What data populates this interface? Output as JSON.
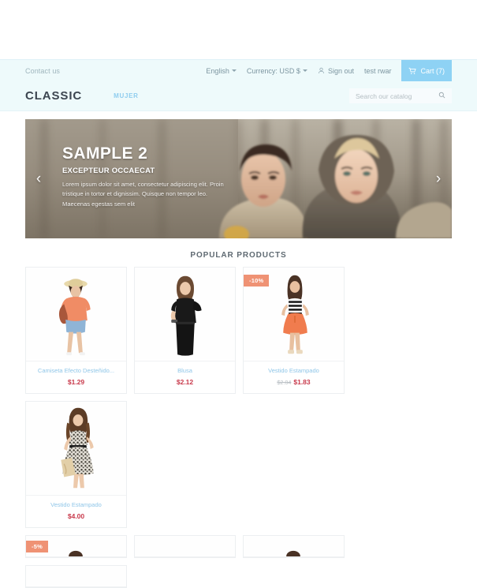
{
  "topbar": {
    "contact_label": "Contact us",
    "language": "English",
    "currency": "Currency: USD $",
    "sign_out": "Sign out",
    "account_name": "test rwar",
    "cart_label": "Cart (7)",
    "user_icon": "user-icon",
    "cart_icon": "cart-icon",
    "accent_color": "#8ed2f4",
    "bar_background": "#eefafb"
  },
  "header": {
    "logo": "CLASSIC",
    "nav": [
      {
        "label": "MUJER"
      }
    ],
    "search": {
      "placeholder": "Search our catalog",
      "value": "",
      "icon": "search-icon"
    }
  },
  "carousel": {
    "title": "SAMPLE 2",
    "subtitle": "EXCEPTEUR OCCAECAT",
    "body": "Lorem ipsum dolor sit amet, consectetur adipiscing elit. Proin tristique in tortor et dignissim. Quisque non tempor leo. Maecenas egestas sem elit",
    "prev_icon": "chevron-left-icon",
    "next_icon": "chevron-right-icon",
    "prev_glyph": "‹",
    "next_glyph": "›"
  },
  "section": {
    "popular_title": "POPULAR PRODUCTS"
  },
  "products": [
    {
      "name": "Camiseta Efecto Desteñido...",
      "price": "$1.29",
      "old_price": "",
      "badge": ""
    },
    {
      "name": "Blusa",
      "price": "$2.12",
      "old_price": "",
      "badge": ""
    },
    {
      "name": "Vestido Estampado",
      "price": "$1.83",
      "old_price": "$2.04",
      "badge": "-10%"
    },
    {
      "name": "Vestido Estampado",
      "price": "$4.00",
      "old_price": "",
      "badge": ""
    }
  ],
  "products_row2": [
    {
      "badge": "-5%"
    },
    {
      "badge": ""
    },
    {
      "badge": ""
    },
    {
      "badge": ""
    }
  ],
  "colors": {
    "price": "#c8394b",
    "product_name": "#8fc6e8",
    "badge": "#ef9274",
    "cart_button": "#8ed2f4"
  }
}
